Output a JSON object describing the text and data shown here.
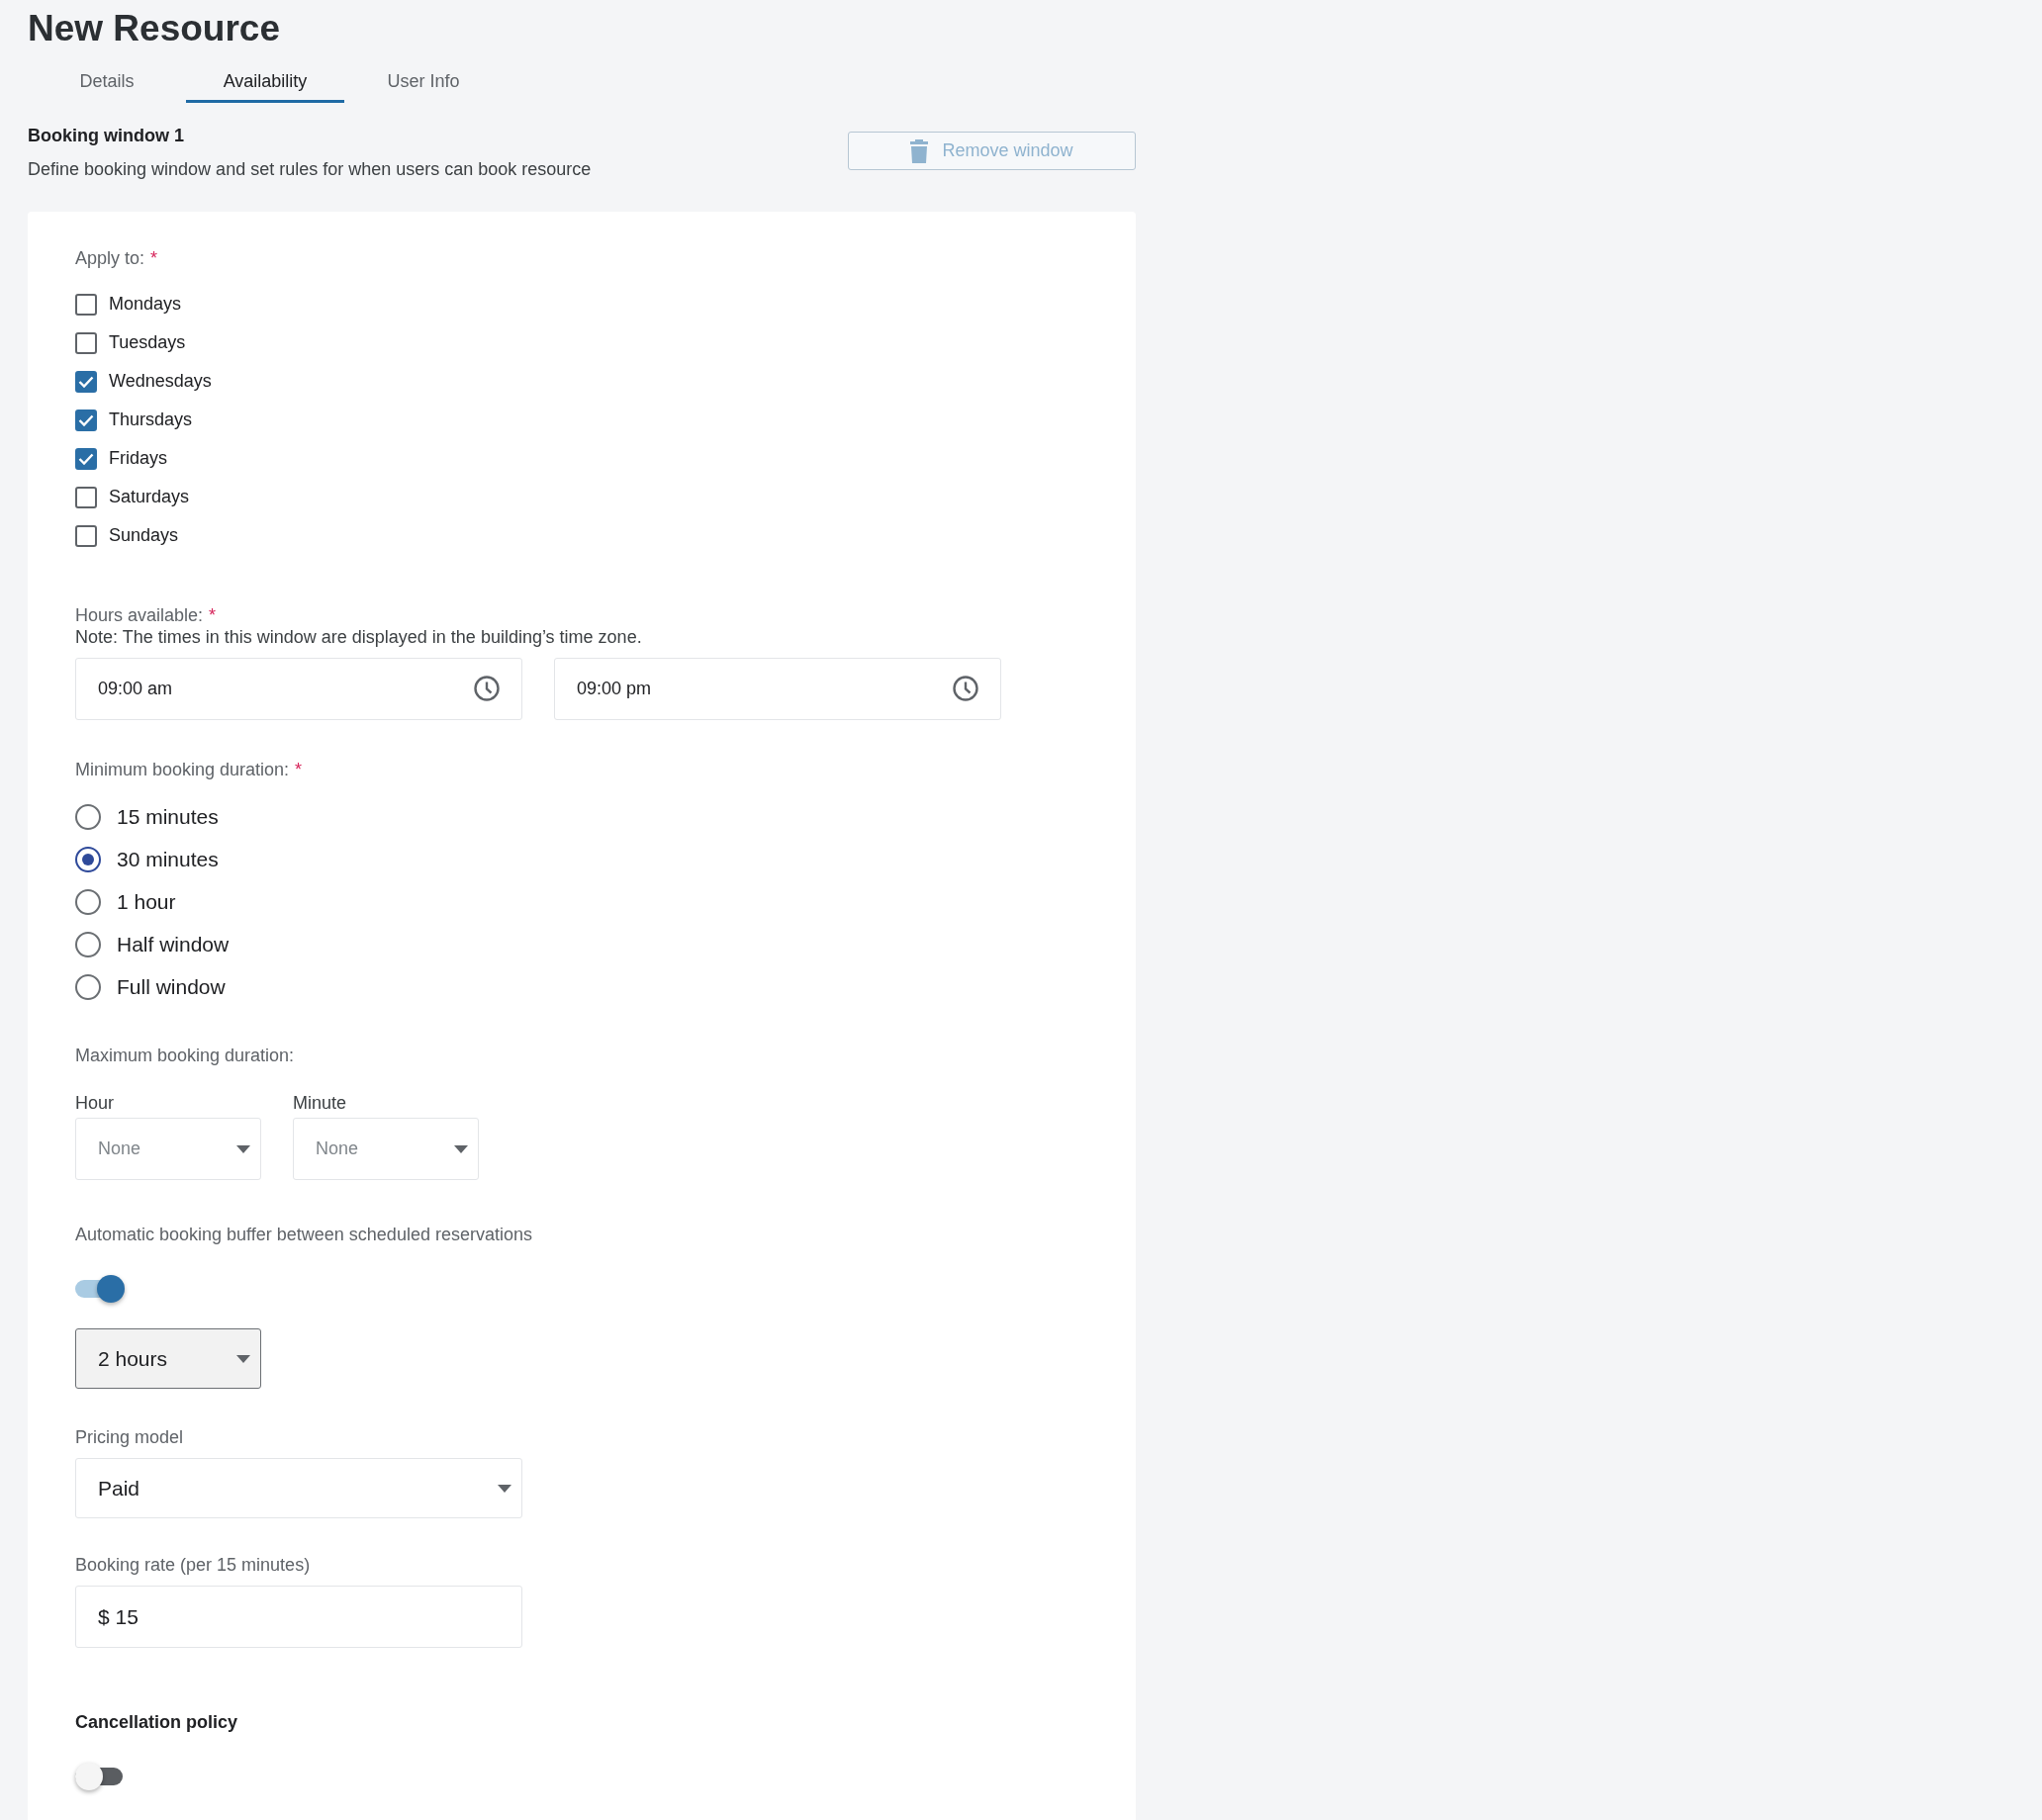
{
  "page": {
    "title": "New Resource"
  },
  "tabs": [
    {
      "label": "Details",
      "selected": false
    },
    {
      "label": "Availability",
      "selected": true
    },
    {
      "label": "User Info",
      "selected": false
    }
  ],
  "window": {
    "title": "Booking window 1",
    "description": "Define booking window and set rules for when users can book resource",
    "remove_button": {
      "label": "Remove window",
      "disabled": true
    }
  },
  "apply_to": {
    "label": "Apply to:",
    "required_mark": "*",
    "days": [
      {
        "label": "Mondays",
        "checked": false
      },
      {
        "label": "Tuesdays",
        "checked": false
      },
      {
        "label": "Wednesdays",
        "checked": true
      },
      {
        "label": "Thursdays",
        "checked": true
      },
      {
        "label": "Fridays",
        "checked": true
      },
      {
        "label": "Saturdays",
        "checked": false
      },
      {
        "label": "Sundays",
        "checked": false
      }
    ]
  },
  "hours": {
    "label": "Hours available:",
    "required_mark": "*",
    "note": "Note: The times in this window are displayed in the building’s time zone.",
    "start": "09:00 am",
    "end": "09:00 pm"
  },
  "min_duration": {
    "label": "Minimum booking duration:",
    "required_mark": "*",
    "options": [
      {
        "label": "15 minutes",
        "selected": false
      },
      {
        "label": "30 minutes",
        "selected": true
      },
      {
        "label": "1 hour",
        "selected": false
      },
      {
        "label": "Half window",
        "selected": false
      },
      {
        "label": "Full window",
        "selected": false
      }
    ]
  },
  "max_duration": {
    "label": "Maximum booking duration:",
    "hour": {
      "label": "Hour",
      "placeholder": "None"
    },
    "minute": {
      "label": "Minute",
      "placeholder": "None"
    }
  },
  "buffer": {
    "label": "Automatic booking buffer between scheduled reservations",
    "on": true,
    "value": "2 hours"
  },
  "pricing": {
    "label": "Pricing model",
    "value": "Paid"
  },
  "rate": {
    "label": "Booking rate (per 15 minutes)",
    "value": "$ 15"
  },
  "cancellation": {
    "label": "Cancellation policy",
    "on": false
  }
}
